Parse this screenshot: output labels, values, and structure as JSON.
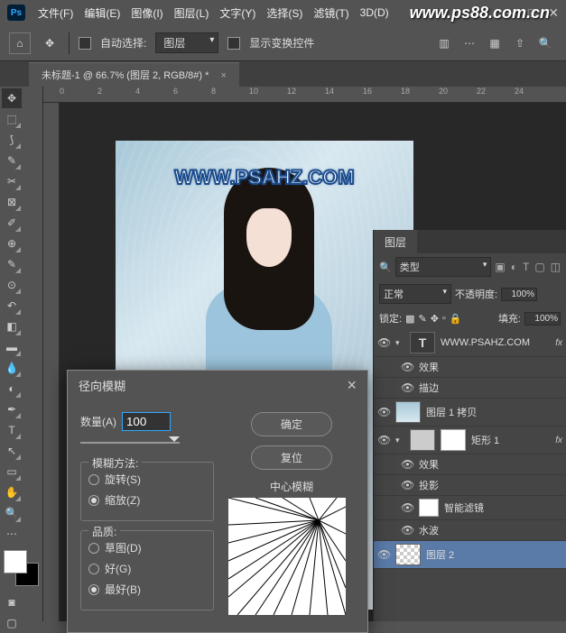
{
  "watermark_top": "www.ps88.com.cn",
  "menu": [
    "文件(F)",
    "编辑(E)",
    "图像(I)",
    "图层(L)",
    "文字(Y)",
    "选择(S)",
    "滤镜(T)",
    "3D(D)"
  ],
  "optbar": {
    "auto_select": "自动选择:",
    "target": "图层",
    "show_transform": "显示变换控件"
  },
  "tab": {
    "title": "未标题-1 @ 66.7% (图层 2, RGB/8#) *"
  },
  "ruler_marks": [
    "0",
    "2",
    "4",
    "6",
    "8",
    "10",
    "12",
    "14",
    "16",
    "18",
    "20",
    "22",
    "24"
  ],
  "canvas_watermark": "WWW.PSAHZ.COM",
  "dialog": {
    "title": "径向模糊",
    "amount_label": "数量(A)",
    "amount_value": "100",
    "ok": "确定",
    "cancel": "复位",
    "method": {
      "title": "模糊方法:",
      "spin": "旋转(S)",
      "zoom": "缩放(Z)"
    },
    "quality": {
      "title": "品质:",
      "draft": "草图(D)",
      "good": "好(G)",
      "best": "最好(B)"
    },
    "preview_label": "中心模糊"
  },
  "panels": {
    "tab": "图层",
    "filter_label": "类型",
    "blend_mode": "正常",
    "opacity_label": "不透明度:",
    "opacity_value": "100%",
    "lock_label": "锁定:",
    "fill_label": "填充:",
    "fill_value": "100%",
    "layers": [
      {
        "type": "text",
        "name": "WWW.PSAHZ.COM",
        "fx": true
      },
      {
        "type": "sub",
        "name": "效果"
      },
      {
        "type": "sub",
        "name": "描边"
      },
      {
        "type": "image",
        "name": "图层 1 拷贝"
      },
      {
        "type": "shape",
        "name": "矩形 1",
        "fx": true,
        "masked": true
      },
      {
        "type": "sub",
        "name": "效果"
      },
      {
        "type": "sub",
        "name": "投影"
      },
      {
        "type": "smart",
        "name": "智能滤镜"
      },
      {
        "type": "sub",
        "name": "水波"
      },
      {
        "type": "image",
        "name": "图层 2",
        "selected": true,
        "checker": true
      }
    ]
  }
}
